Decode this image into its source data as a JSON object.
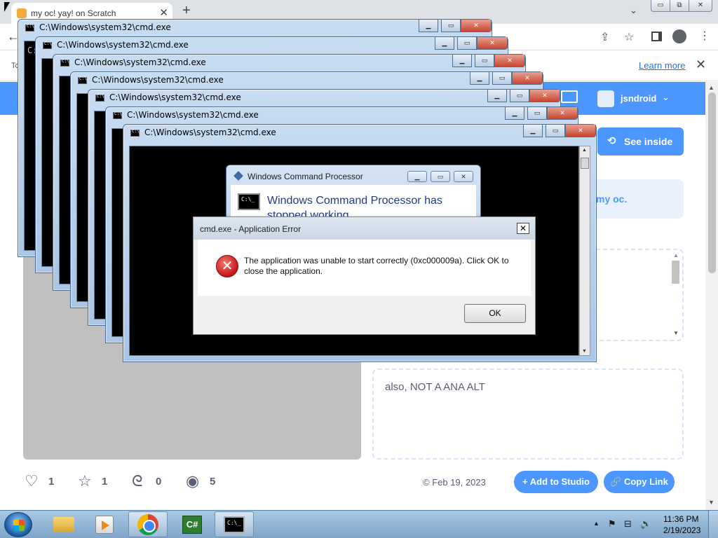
{
  "browser": {
    "tab_title": "my oc! yay! on Scratch",
    "tab_close": "✕",
    "new_tab": "+",
    "tab_search": "⌄",
    "back": "←",
    "learn_more": "Learn more",
    "infobar_left": "To",
    "infobar_close": "✕",
    "window_min": "▭",
    "window_max": "⧉",
    "window_close": "✕"
  },
  "scratch": {
    "username": "jsndroid",
    "see_inside": "See inside",
    "notes_fragment": "my oc.",
    "credits_text": "also, NOT A ANA ALT",
    "stats": {
      "loves": "1",
      "favorites": "1",
      "remixes": "0",
      "views": "5"
    },
    "shared_date": "© Feb 19, 2023",
    "add_to_studio": "+ Add to Studio",
    "copy_link": "🔗 Copy Link"
  },
  "cmd_windows": {
    "title": "C:\\Windows\\system32\\cmd.exe",
    "prompt": "C:"
  },
  "wcp_dialog": {
    "title": "Windows Command Processor",
    "heading": "Windows Command Processor has stopped working"
  },
  "error_dialog": {
    "title": "cmd.exe - Application Error",
    "message": "The application was unable to start correctly (0xc000009a). Click OK to close the application.",
    "ok": "OK",
    "close": "✕",
    "icon_glyph": "✕"
  },
  "taskbar": {
    "time": "11:36 PM",
    "date": "2/19/2023",
    "csharp_label": "C#"
  },
  "icons": {
    "share": "⇪",
    "star": "☆",
    "kebab": "⋮",
    "chevron": "⌄",
    "heart": "♡",
    "fav_star": "☆",
    "remix": "ᘓ",
    "eye": "◉",
    "tray_up": "▲",
    "tray_flag": "⚑",
    "tray_network": "⊟",
    "tray_volume": "🔈"
  }
}
